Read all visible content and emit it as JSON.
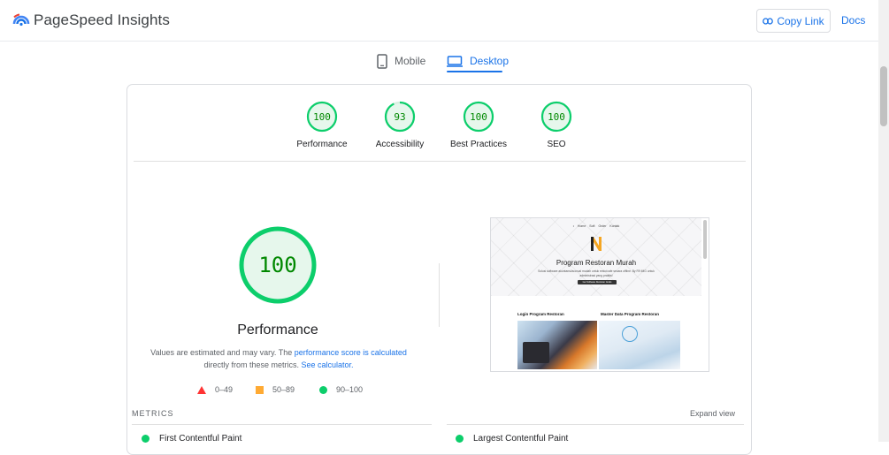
{
  "header": {
    "app_title": "PageSpeed Insights",
    "copy_link_label": "Copy Link",
    "docs_label": "Docs",
    "brand_colors": [
      "#1a73e8",
      "#4285f4",
      "#ea4335"
    ]
  },
  "tabs": [
    {
      "label": "Mobile",
      "icon": "mobile-phone-icon",
      "selected": false
    },
    {
      "label": "Desktop",
      "icon": "desktop-monitor-icon",
      "selected": true
    }
  ],
  "scores": [
    {
      "label": "Performance",
      "value": "100"
    },
    {
      "label": "Accessibility",
      "value": "93"
    },
    {
      "label": "Best Practices",
      "value": "100"
    },
    {
      "label": "SEO",
      "value": "100"
    }
  ],
  "performance": {
    "score": "100",
    "title": "Performance",
    "desc_prefix": "Values are estimated and may vary. The ",
    "desc_link1": "performance score is calculated",
    "desc_middle": " directly from these metrics. ",
    "desc_link2": "See calculator."
  },
  "legend": {
    "fail": "0–49",
    "average": "50–89",
    "pass": "90–100",
    "colors": {
      "fail": "#ff3333",
      "average": "#ffaa33",
      "pass": "#0cce6b"
    }
  },
  "preview": {
    "nav": "• Home   Soft   Order   Kontak",
    "title": "Program Restoran Murah",
    "subtitle": "Solusi software akuntansi/accrual mudah untuk resto/cafe secara offline. By R9 IMG untuk administrasi yang praktis!",
    "button": "Get Software Restoran Gratis Sekarang",
    "section_left": "Login Program Restoran",
    "section_right": "Master Data Program Restoran"
  },
  "metrics": {
    "label": "METRICS",
    "expand_label": "Expand view",
    "items": [
      "First Contentful Paint",
      "Largest Contentful Paint"
    ]
  }
}
